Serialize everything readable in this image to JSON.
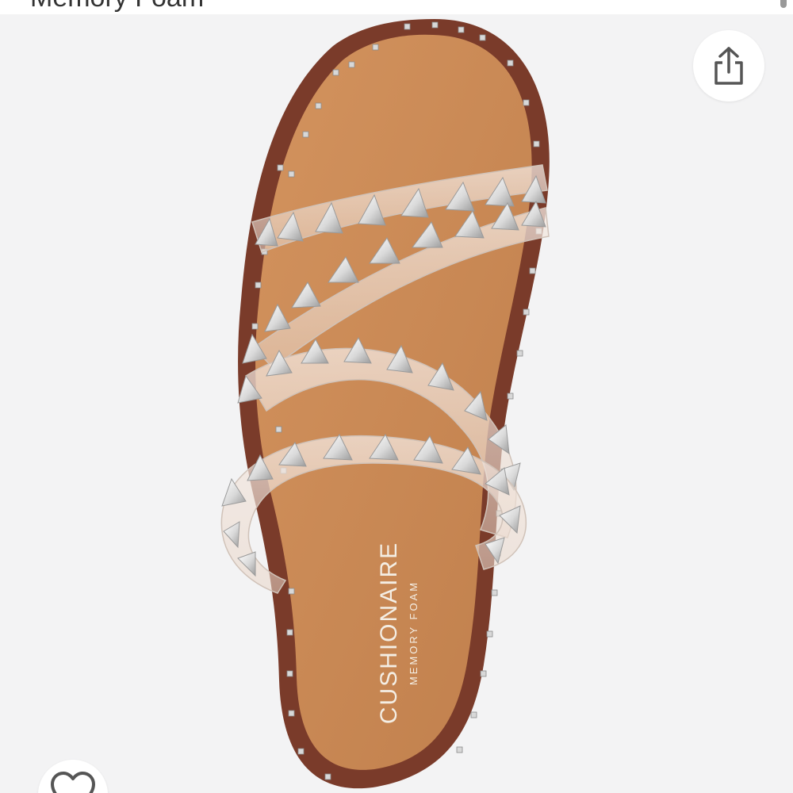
{
  "header": {
    "title": "Memory Foam"
  },
  "product": {
    "image": {
      "icon": "clear-studded-slide-sandal-image",
      "insole_brand": "CUSHIONAIRE",
      "insole_subtitle": "MEMORY FOAM"
    }
  },
  "actions": {
    "share_icon": "share-icon",
    "favorite_icon": "heart-icon"
  },
  "colors": {
    "background": "#f3f3f4",
    "footbed": "#c98a55",
    "rim": "#7a3b2a",
    "accent": "#2b4e61"
  }
}
